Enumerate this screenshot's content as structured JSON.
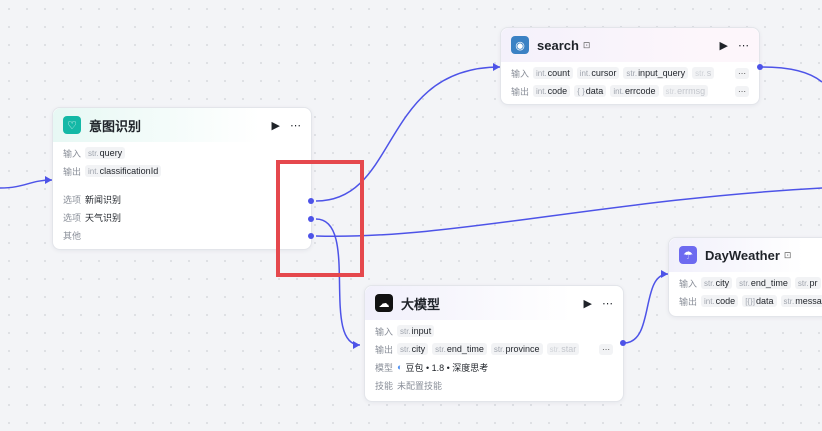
{
  "colors": {
    "edge": "#4d53e8",
    "selection": "#e5484d",
    "intent_icon": "#14b8a6"
  },
  "labels": {
    "input": "输入",
    "output": "输出",
    "option": "选项",
    "other": "其他",
    "model": "模型",
    "skills": "技能"
  },
  "intent_node": {
    "title": "意图识别",
    "icon": "intent-icon",
    "inputs": [
      {
        "type": "str.",
        "name": "query"
      }
    ],
    "outputs": [
      {
        "type": "int.",
        "name": "classificationId"
      }
    ],
    "options": [
      "新闻识别",
      "天气识别"
    ]
  },
  "search_node": {
    "title": "search",
    "icon": "plugin-icon",
    "inputs": [
      {
        "type": "int.",
        "name": "count"
      },
      {
        "type": "int.",
        "name": "cursor"
      },
      {
        "type": "str.",
        "name": "input_query"
      },
      {
        "type": "str.",
        "name": "s"
      }
    ],
    "outputs": [
      {
        "type": "int.",
        "name": "code"
      },
      {
        "type": "{ }",
        "name": "data"
      },
      {
        "type": "int.",
        "name": "errcode"
      },
      {
        "type": "str.",
        "name": "errmsg"
      }
    ]
  },
  "llm_node": {
    "title": "大模型",
    "icon": "llm-icon",
    "inputs": [
      {
        "type": "str.",
        "name": "input"
      }
    ],
    "outputs": [
      {
        "type": "str.",
        "name": "city"
      },
      {
        "type": "str.",
        "name": "end_time"
      },
      {
        "type": "str.",
        "name": "province"
      },
      {
        "type": "str.",
        "name": "star"
      }
    ],
    "model": "豆包 • 1.8 • 深度思考",
    "skills": "未配置技能"
  },
  "weather_node": {
    "title": "DayWeather",
    "icon": "weather-icon",
    "inputs": [
      {
        "type": "str.",
        "name": "city"
      },
      {
        "type": "str.",
        "name": "end_time"
      },
      {
        "type": "str.",
        "name": "pr"
      }
    ],
    "outputs": [
      {
        "type": "int.",
        "name": "code"
      },
      {
        "type": "[{}]",
        "name": "data"
      },
      {
        "type": "str.",
        "name": "messa"
      }
    ]
  }
}
